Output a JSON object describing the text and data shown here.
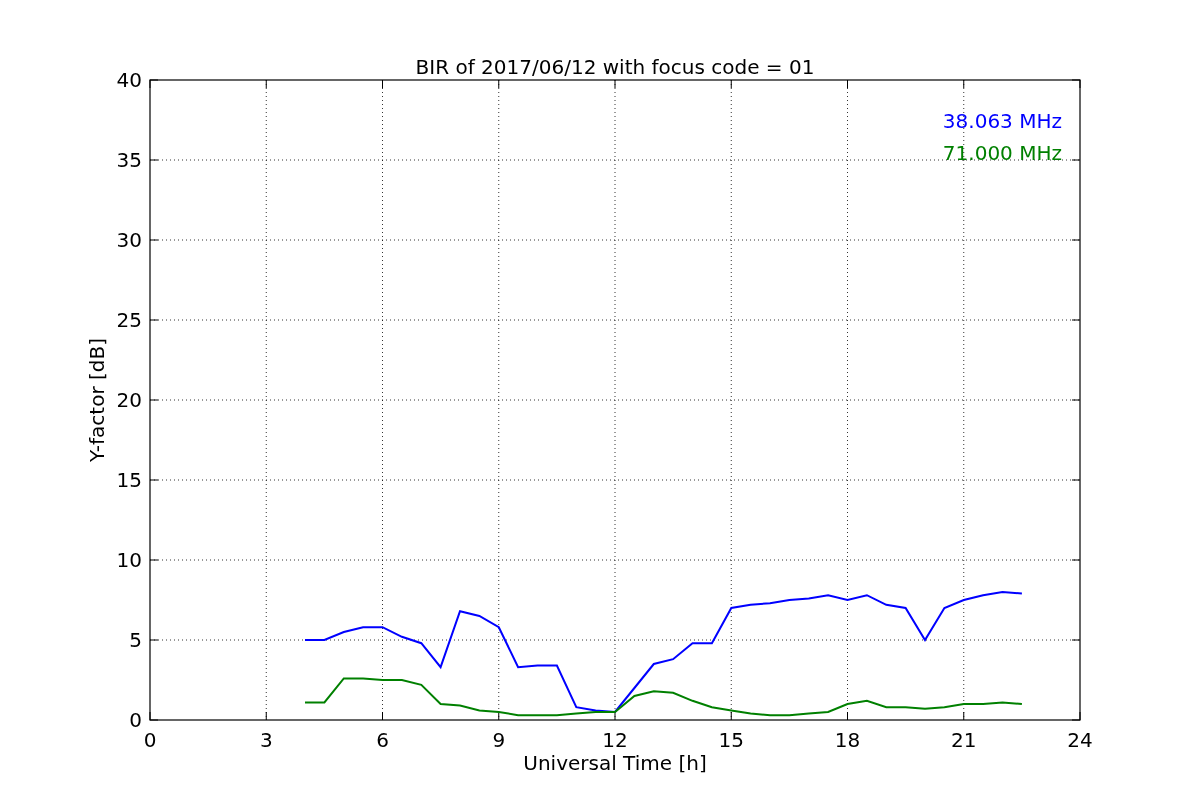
{
  "chart_data": {
    "type": "line",
    "title": "BIR of 2017/06/12 with focus code = 01",
    "xlabel": "Universal Time [h]",
    "ylabel": "Y-factor [dB]",
    "x": [
      4,
      4.5,
      5,
      5.5,
      6,
      6.5,
      7,
      7.5,
      8,
      8.5,
      9,
      9.5,
      10,
      10.5,
      11,
      11.5,
      12,
      12.5,
      13,
      13.5,
      14,
      14.5,
      15,
      15.5,
      16,
      16.5,
      17,
      17.5,
      18,
      18.5,
      19,
      19.5,
      20,
      20.5,
      21,
      21.5,
      22,
      22.5
    ],
    "series": [
      {
        "name": "38.063 MHz",
        "color": "#0000ff",
        "values": [
          5,
          5,
          5.5,
          5.8,
          5.8,
          5.2,
          4.8,
          3.3,
          6.8,
          6.5,
          5.8,
          3.3,
          3.4,
          3.4,
          0.8,
          0.6,
          0.5,
          2.0,
          3.5,
          3.8,
          4.8,
          4.8,
          7.0,
          7.2,
          7.3,
          7.5,
          7.6,
          7.8,
          7.5,
          7.8,
          7.2,
          7.0,
          5.0,
          7.0,
          7.5,
          7.8,
          8.0,
          7.9
        ]
      },
      {
        "name": "71.000 MHz",
        "color": "#008000",
        "values": [
          1.1,
          1.1,
          2.6,
          2.6,
          2.5,
          2.5,
          2.2,
          1.0,
          0.9,
          0.6,
          0.5,
          0.3,
          0.3,
          0.3,
          0.4,
          0.5,
          0.5,
          1.5,
          1.8,
          1.7,
          1.2,
          0.8,
          0.6,
          0.4,
          0.3,
          0.3,
          0.4,
          0.5,
          1.0,
          1.2,
          0.8,
          0.8,
          0.7,
          0.8,
          1.0,
          1.0,
          1.1,
          1.0
        ]
      }
    ],
    "grid": true,
    "xlim": [
      0,
      24
    ],
    "ylim": [
      0,
      40
    ],
    "xticks": [
      0,
      3,
      6,
      9,
      12,
      15,
      18,
      21,
      24
    ],
    "yticks": [
      0,
      5,
      10,
      15,
      20,
      25,
      30,
      35,
      40
    ]
  }
}
